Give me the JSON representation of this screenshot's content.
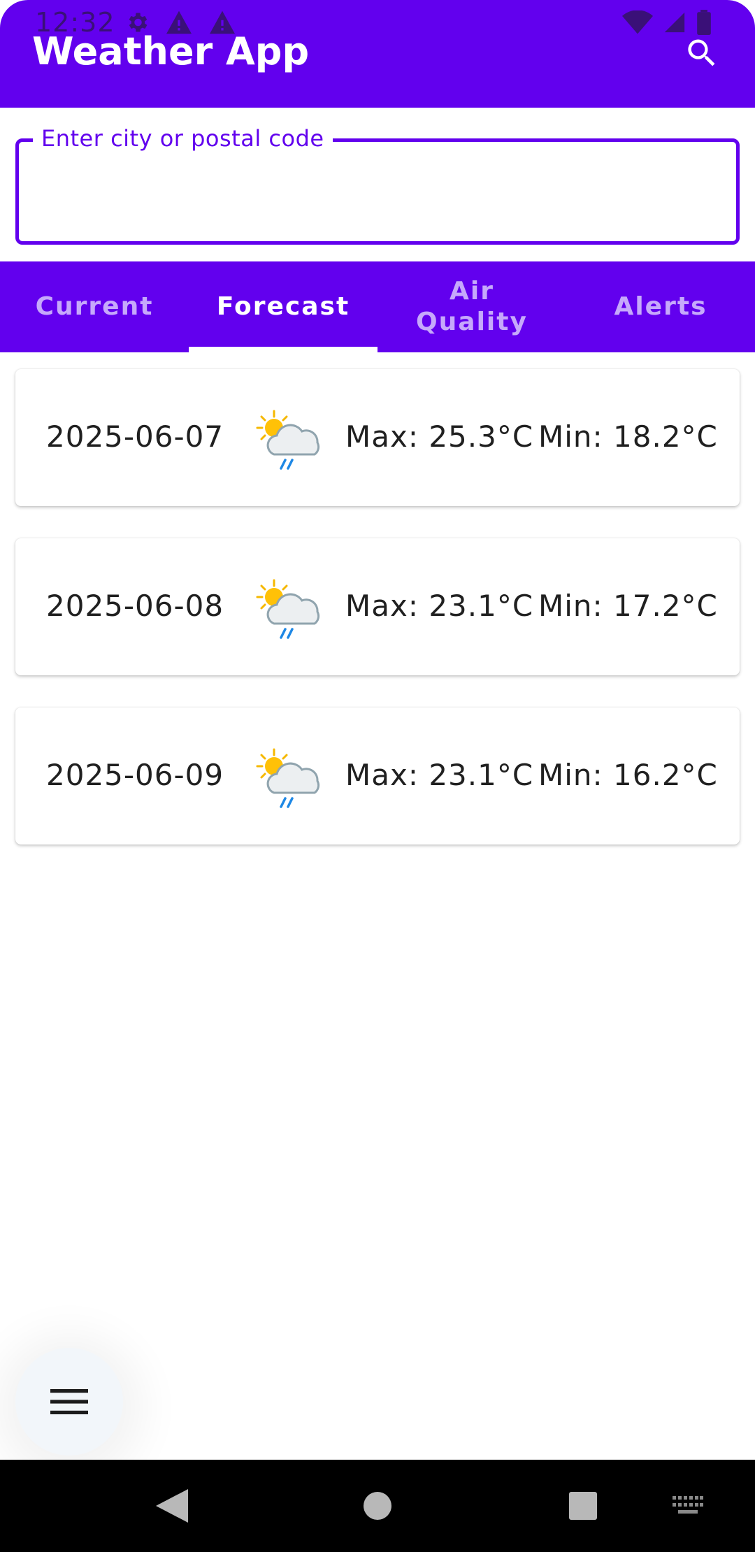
{
  "status_bar": {
    "time": "12:32",
    "left_icons": [
      "gear-icon",
      "alert-icon",
      "alert-icon"
    ],
    "right_icons": [
      "wifi-icon",
      "signal-icon",
      "battery-icon"
    ]
  },
  "app_bar": {
    "title": "Weather App",
    "search_icon": "search-icon"
  },
  "search": {
    "label": "Enter city or postal code",
    "value": "",
    "placeholder": ""
  },
  "tabs": [
    {
      "label": "Current",
      "active": false
    },
    {
      "label": "Forecast",
      "active": true
    },
    {
      "label": "Air\nQuality",
      "active": false
    },
    {
      "label": "Alerts",
      "active": false
    }
  ],
  "forecast": [
    {
      "date": "2025-06-07",
      "icon": "partly-cloudy-rain-icon",
      "max": "Max: 25.3°C",
      "min": "Min: 18.2°C"
    },
    {
      "date": "2025-06-08",
      "icon": "partly-cloudy-rain-icon",
      "max": "Max: 23.1°C",
      "min": "Min: 17.2°C"
    },
    {
      "date": "2025-06-09",
      "icon": "partly-cloudy-rain-icon",
      "max": "Max: 23.1°C",
      "min": "Min: 16.2°C"
    }
  ],
  "fab": {
    "icon": "menu-icon"
  },
  "nav_bar": {
    "icons": [
      "back-icon",
      "home-icon",
      "recents-icon",
      "keyboard-icon"
    ]
  },
  "colors": {
    "primary": "#6200ee",
    "tab_inactive": "#c6a9fb",
    "fab_background": "#f2f6fa"
  }
}
